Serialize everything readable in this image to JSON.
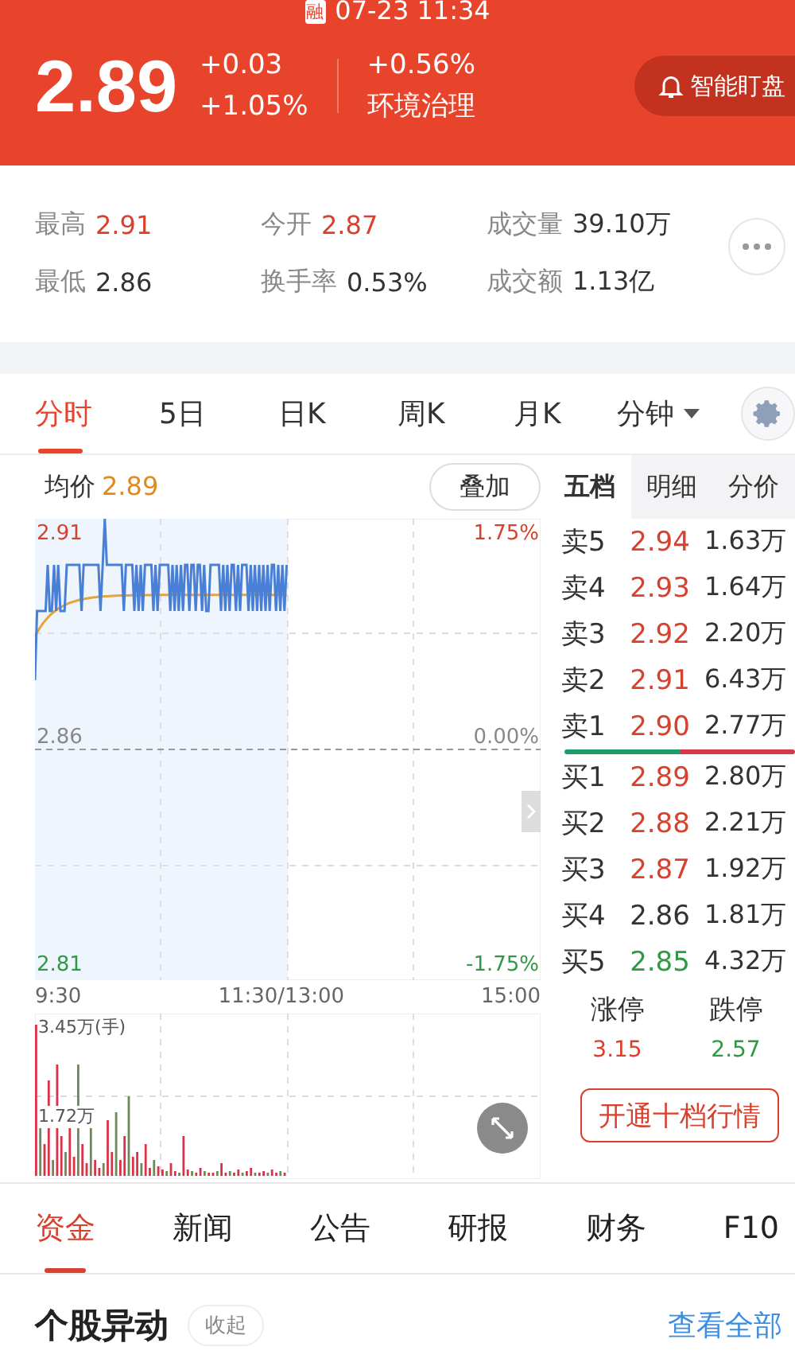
{
  "status": {
    "badge": "融",
    "datetime": "07-23 11:34"
  },
  "quote": {
    "price": "2.89",
    "change": "+0.03",
    "change_pct": "+1.05%",
    "sector_change": "+0.56%",
    "sector": "环境治理",
    "watch_button": "智能盯盘"
  },
  "stats": [
    {
      "label": "最高",
      "value": "2.91",
      "color": "#d9412f"
    },
    {
      "label": "今开",
      "value": "2.87",
      "color": "#d9412f"
    },
    {
      "label": "成交量",
      "value": "39.10万",
      "color": "#333333"
    },
    {
      "label": "最低",
      "value": "2.86",
      "color": "#333333"
    },
    {
      "label": "换手率",
      "value": "0.53%",
      "color": "#333333"
    },
    {
      "label": "成交额",
      "value": "1.13亿",
      "color": "#333333"
    }
  ],
  "chart_tabs": [
    {
      "label": "分时",
      "selected": true
    },
    {
      "label": "5日",
      "selected": false
    },
    {
      "label": "日K",
      "selected": false
    },
    {
      "label": "周K",
      "selected": false
    },
    {
      "label": "月K",
      "selected": false
    },
    {
      "label": "分钟",
      "selected": false,
      "kind": "dropdown"
    }
  ],
  "intraday": {
    "avg_label": "均价",
    "avg_value": "2.89",
    "overlay_button": "叠加",
    "price_high": "2.91",
    "price_mid": "2.86",
    "price_low": "2.81",
    "pct_high": "1.75%",
    "pct_mid": "0.00%",
    "pct_low": "-1.75%",
    "times": [
      "9:30",
      "11:30/13:00",
      "15:00"
    ],
    "volume_max": "3.45万(手)",
    "volume_mid": "1.72万"
  },
  "order_book": {
    "tabs": [
      {
        "label": "五档",
        "selected": true
      },
      {
        "label": "明细",
        "selected": false
      },
      {
        "label": "分价",
        "selected": false
      }
    ],
    "asks": [
      {
        "label": "卖5",
        "price": "2.94",
        "volume": "1.63万",
        "color": "#d9412f"
      },
      {
        "label": "卖4",
        "price": "2.93",
        "volume": "1.64万",
        "color": "#d9412f"
      },
      {
        "label": "卖3",
        "price": "2.92",
        "volume": "2.20万",
        "color": "#d9412f"
      },
      {
        "label": "卖2",
        "price": "2.91",
        "volume": "6.43万",
        "color": "#d9412f"
      },
      {
        "label": "卖1",
        "price": "2.90",
        "volume": "2.77万",
        "color": "#d9412f"
      }
    ],
    "bids": [
      {
        "label": "买1",
        "price": "2.89",
        "volume": "2.80万",
        "color": "#d9412f"
      },
      {
        "label": "买2",
        "price": "2.88",
        "volume": "2.21万",
        "color": "#d9412f"
      },
      {
        "label": "买3",
        "price": "2.87",
        "volume": "1.92万",
        "color": "#d9412f"
      },
      {
        "label": "买4",
        "price": "2.86",
        "volume": "1.81万",
        "color": "#333333"
      },
      {
        "label": "买5",
        "price": "2.85",
        "volume": "4.32万",
        "color": "#2f9a45"
      }
    ],
    "limits": [
      {
        "label": "涨停",
        "value": "3.15",
        "color": "#d9412f"
      },
      {
        "label": "跌停",
        "value": "2.57",
        "color": "#2f9a45"
      }
    ],
    "upgrade_button": "开通十档行情"
  },
  "info_tabs": [
    {
      "label": "资金",
      "selected": true
    },
    {
      "label": "新闻",
      "selected": false
    },
    {
      "label": "公告",
      "selected": false
    },
    {
      "label": "研报",
      "selected": false
    },
    {
      "label": "财务",
      "selected": false
    },
    {
      "label": "F10",
      "selected": false
    }
  ],
  "section": {
    "title": "个股异动",
    "collapse_button": "收起",
    "view_all": "查看全部"
  }
}
